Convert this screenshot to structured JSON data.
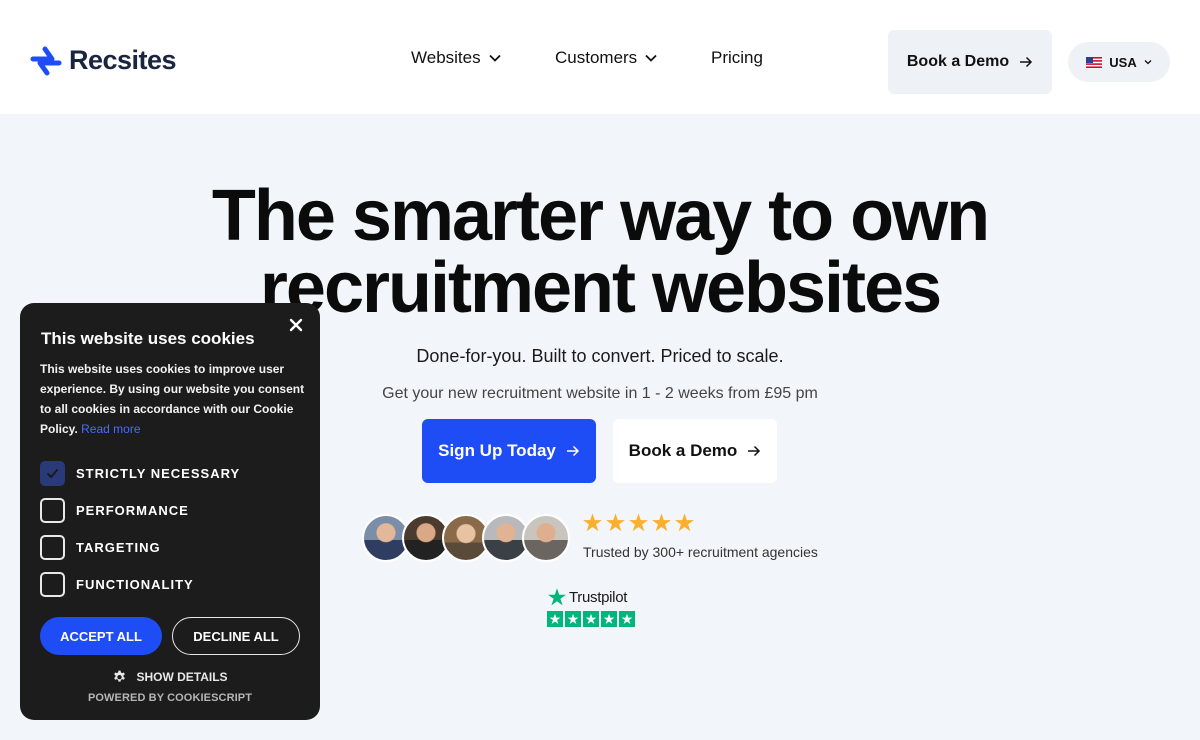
{
  "brand": {
    "name": "Recsites",
    "color": "#1f4df5"
  },
  "nav": {
    "websites": "Websites",
    "customers": "Customers",
    "pricing": "Pricing"
  },
  "header": {
    "book_demo": "Book a Demo",
    "locale": "USA",
    "locale_flag": "us-flag-icon"
  },
  "hero": {
    "title_line1": "The smarter way to own",
    "title_line2": "recruitment websites",
    "tagline": "Done-for-you. Built to convert. Priced to scale.",
    "subline": "Get your new recruitment website in 1 - 2 weeks from £95 pm",
    "cta_primary": "Sign Up Today",
    "cta_secondary": "Book a Demo",
    "rating_stars": 5,
    "trusted": "Trusted by 300+ recruitment agencies",
    "trustpilot": "Trustpilot",
    "trustpilot_stars": 5
  },
  "cookie": {
    "title": "This website uses cookies",
    "body": "This website uses cookies to improve user experience. By using our website you consent to all cookies in accordance with our Cookie Policy.",
    "read_more": "Read more",
    "options": [
      {
        "label": "STRICTLY NECESSARY",
        "checked": true
      },
      {
        "label": "PERFORMANCE",
        "checked": false
      },
      {
        "label": "TARGETING",
        "checked": false
      },
      {
        "label": "FUNCTIONALITY",
        "checked": false
      }
    ],
    "accept": "ACCEPT ALL",
    "decline": "DECLINE ALL",
    "show_details": "SHOW DETAILS",
    "powered_by": "POWERED BY COOKIESCRIPT"
  },
  "colors": {
    "accent": "#1f4df5",
    "star_gold": "#fbb02d",
    "trustpilot_green": "#00b67a",
    "cookie_bg": "#1c1c1c",
    "hero_bg": "#f2f6fa"
  }
}
